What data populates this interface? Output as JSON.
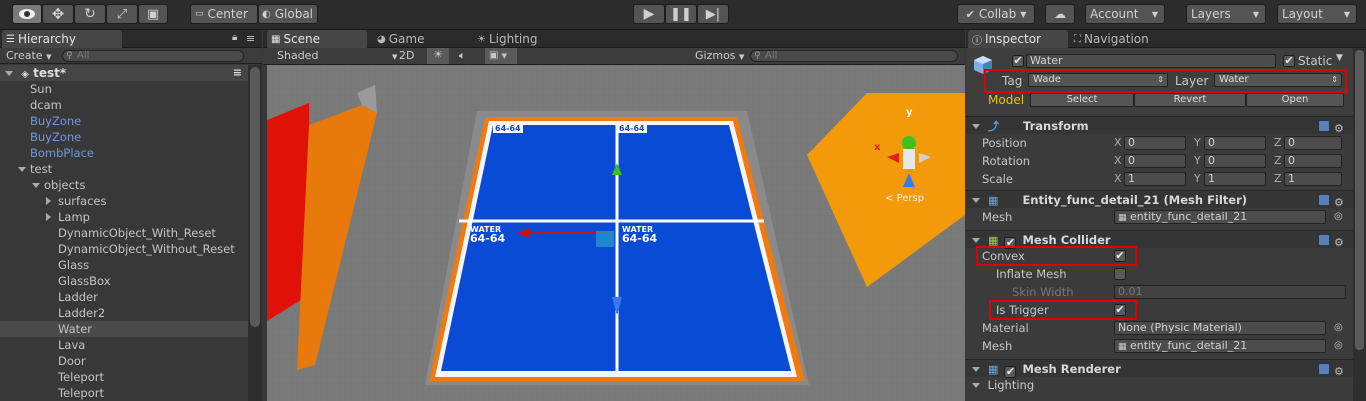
{
  "toolbar": {
    "pivot_label": "Center",
    "space_label": "Global",
    "collab_label": "Collab",
    "account_label": "Account",
    "layers_label": "Layers",
    "layout_label": "Layout"
  },
  "hierarchy": {
    "tab_label": "Hierarchy",
    "create_label": "Create",
    "search_placeholder": "All",
    "scene_name": "test*",
    "items": [
      {
        "label": "Sun",
        "indent": 1,
        "expander": "",
        "color": "normal"
      },
      {
        "label": "dcam",
        "indent": 1,
        "expander": "",
        "color": "normal"
      },
      {
        "label": "BuyZone",
        "indent": 1,
        "expander": "",
        "color": "blue"
      },
      {
        "label": "BuyZone",
        "indent": 1,
        "expander": "",
        "color": "blue"
      },
      {
        "label": "BombPlace",
        "indent": 1,
        "expander": "",
        "color": "blue"
      },
      {
        "label": "test",
        "indent": 1,
        "expander": "down",
        "color": "normal"
      },
      {
        "label": "objects",
        "indent": 2,
        "expander": "down",
        "color": "normal"
      },
      {
        "label": "surfaces",
        "indent": 3,
        "expander": "right",
        "color": "normal"
      },
      {
        "label": "Lamp",
        "indent": 3,
        "expander": "right",
        "color": "normal"
      },
      {
        "label": "DynamicObject_With_Reset",
        "indent": 3,
        "expander": "",
        "color": "normal"
      },
      {
        "label": "DynamicObject_Without_Reset",
        "indent": 3,
        "expander": "",
        "color": "normal"
      },
      {
        "label": "Glass",
        "indent": 3,
        "expander": "",
        "color": "normal"
      },
      {
        "label": "GlassBox",
        "indent": 3,
        "expander": "",
        "color": "normal"
      },
      {
        "label": "Ladder",
        "indent": 3,
        "expander": "",
        "color": "normal"
      },
      {
        "label": "Ladder2",
        "indent": 3,
        "expander": "",
        "color": "normal"
      },
      {
        "label": "Water",
        "indent": 3,
        "expander": "",
        "color": "selected"
      },
      {
        "label": "Lava",
        "indent": 3,
        "expander": "",
        "color": "normal"
      },
      {
        "label": "Door",
        "indent": 3,
        "expander": "",
        "color": "normal"
      },
      {
        "label": "Teleport",
        "indent": 3,
        "expander": "",
        "color": "normal"
      },
      {
        "label": "Teleport",
        "indent": 3,
        "expander": "",
        "color": "normal"
      }
    ]
  },
  "scene": {
    "tabs": [
      "Scene",
      "Game",
      "Lighting"
    ],
    "shading_mode": "Shaded",
    "mode_2d": "2D",
    "gizmos_label": "Gizmos",
    "search_placeholder": "All",
    "water_label_line1": "WATER",
    "water_label_line2": "64-64",
    "small_label": "64-64",
    "persp_label": "Persp",
    "gizmo_x": "x",
    "gizmo_y": "y"
  },
  "inspector": {
    "tabs": [
      "Inspector",
      "Navigation"
    ],
    "object_name": "Water",
    "static_label": "Static",
    "tag_label": "Tag",
    "tag_value": "Wade",
    "layer_label": "Layer",
    "layer_value": "Water",
    "model_label": "Model",
    "select_label": "Select",
    "revert_label": "Revert",
    "open_label": "Open",
    "transform": {
      "title": "Transform",
      "rows": [
        {
          "label": "Position",
          "x": "0",
          "y": "0",
          "z": "0"
        },
        {
          "label": "Rotation",
          "x": "0",
          "y": "0",
          "z": "0"
        },
        {
          "label": "Scale",
          "x": "1",
          "y": "1",
          "z": "1"
        }
      ]
    },
    "mesh_filter": {
      "title": "Entity_func_detail_21 (Mesh Filter)",
      "mesh_label": "Mesh",
      "mesh_value": "entity_func_detail_21"
    },
    "mesh_collider": {
      "title": "Mesh Collider",
      "convex_label": "Convex",
      "inflate_label": "Inflate Mesh",
      "skin_label": "Skin Width",
      "skin_value": "0.01",
      "trigger_label": "Is Trigger",
      "material_label": "Material",
      "material_value": "None (Physic Material)",
      "mesh_label": "Mesh",
      "mesh_value": "entity_func_detail_21"
    },
    "mesh_renderer": {
      "title": "Mesh Renderer",
      "lighting_label": "Lighting"
    },
    "axes": {
      "x": "X",
      "y": "Y",
      "z": "Z"
    }
  }
}
